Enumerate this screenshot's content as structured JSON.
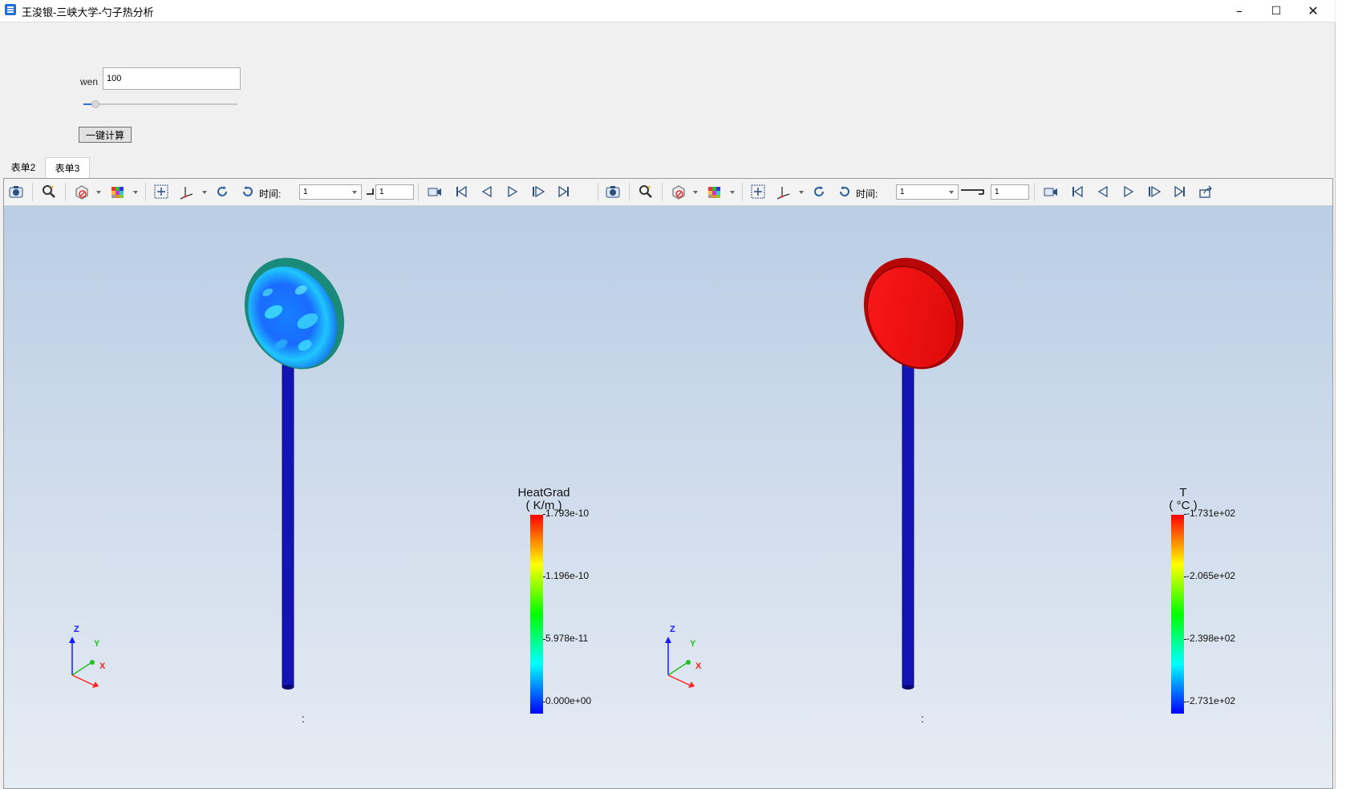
{
  "window": {
    "title": "王浚银-三峡大学-勺子热分析"
  },
  "form": {
    "wen_label": "wen",
    "wen_value": "100",
    "slider_fraction": 0.08,
    "calc_label": "一键计算"
  },
  "tabs": [
    {
      "label": "表单2"
    },
    {
      "label": "表单3"
    }
  ],
  "toolbar": {
    "time_label": "时间:",
    "time_value": "1",
    "step_value": "1"
  },
  "views": [
    {
      "legend_title": "HeatGrad",
      "legend_unit": "( K/m )",
      "ticks": [
        "1.793e-10",
        "1.196e-10",
        "5.978e-11",
        "0.000e+00"
      ],
      "bowl_color": "#1a6cff",
      "handle_color": "#1414b4"
    },
    {
      "legend_title": "T",
      "legend_unit": "( °C )",
      "ticks": [
        "-1.731e+02",
        "-2.065e+02",
        "-2.398e+02",
        "-2.731e+02"
      ],
      "bowl_color": "#f01010",
      "handle_color": "#1414b4"
    }
  ],
  "triad": {
    "x": "X",
    "y": "Y",
    "z": "Z"
  },
  "status_text": ":"
}
